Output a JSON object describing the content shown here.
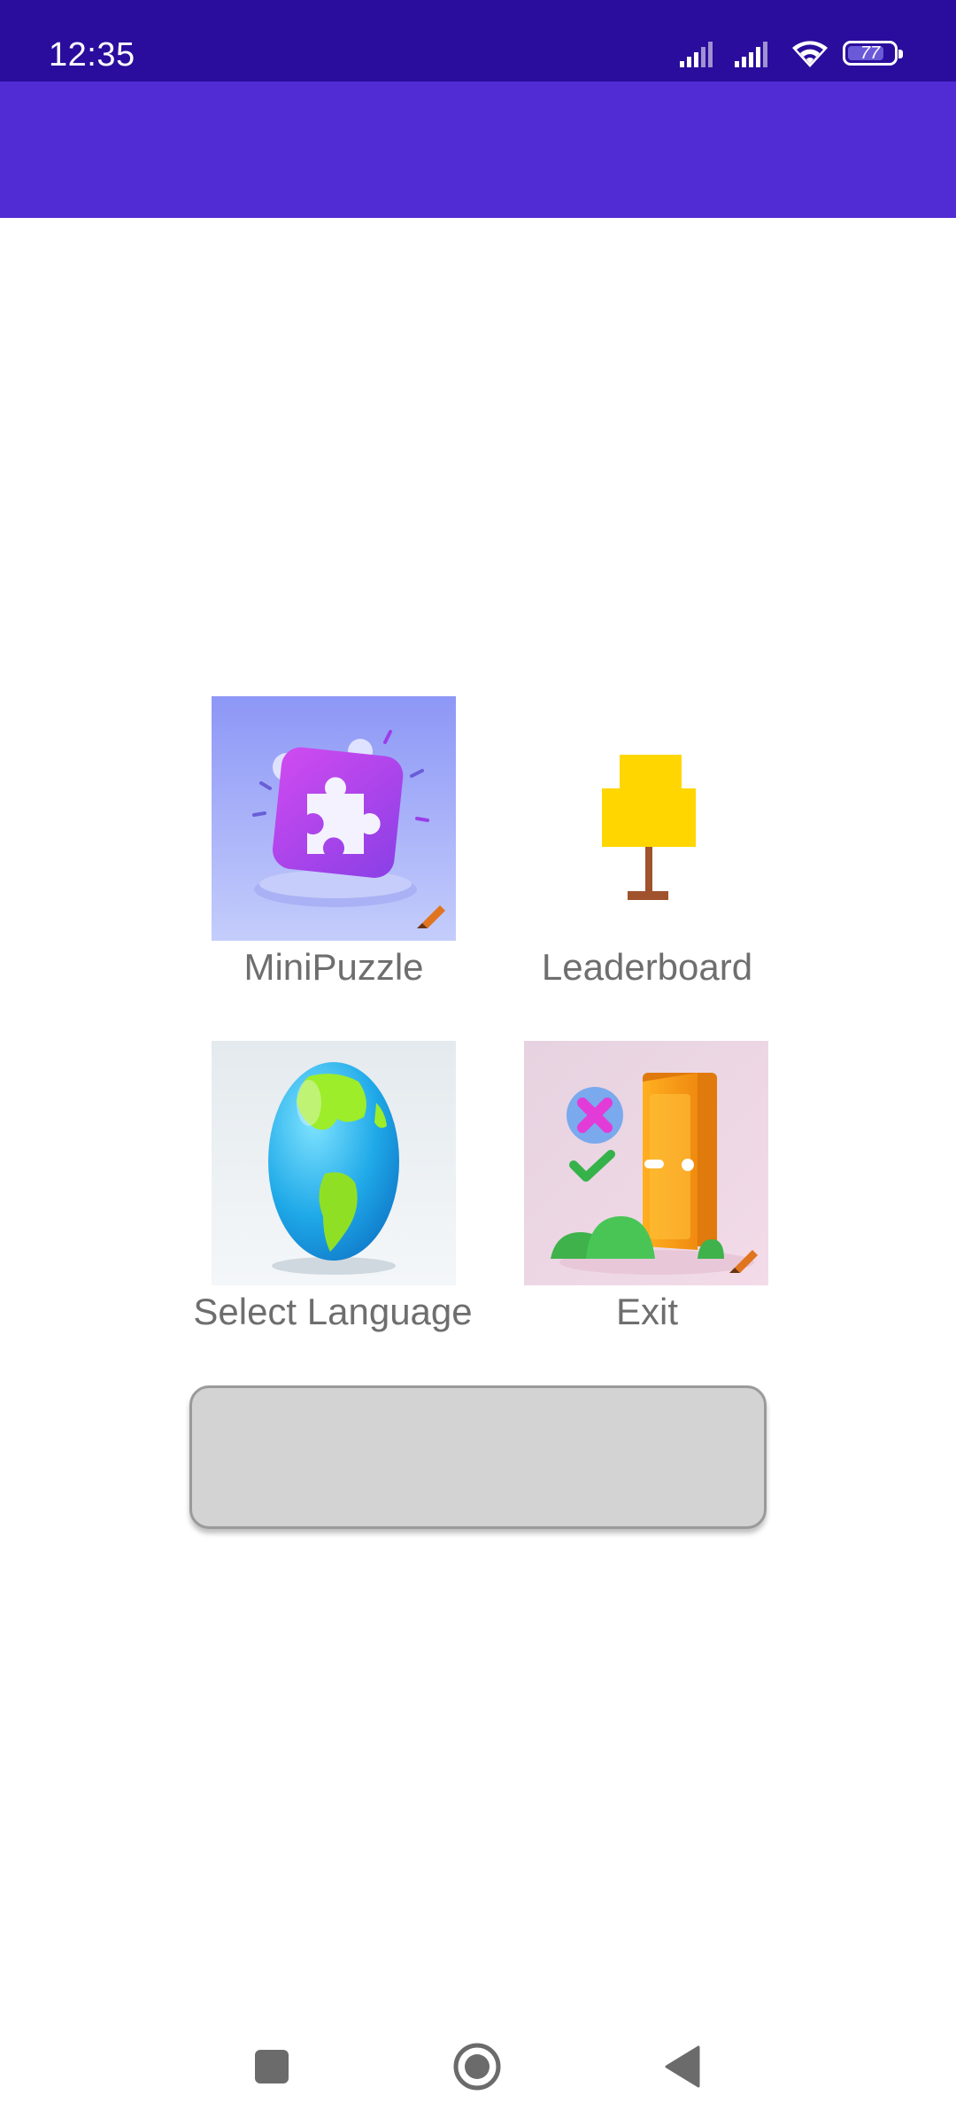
{
  "status_bar": {
    "time": "12:35",
    "battery": "77",
    "icons": [
      "signal-icon",
      "signal-icon",
      "wifi-icon",
      "battery-icon"
    ]
  },
  "app_bar": {
    "color": "#512bd4"
  },
  "menu": {
    "items": [
      {
        "label": "MiniPuzzle",
        "icon": "puzzle-icon"
      },
      {
        "label": "Leaderboard",
        "icon": "trophy-lamp-icon"
      },
      {
        "label": "Select Language",
        "icon": "globe-icon"
      },
      {
        "label": "Exit",
        "icon": "door-icon"
      }
    ]
  },
  "action_button": {
    "label": ""
  },
  "nav": {
    "items": [
      "recents-icon",
      "home-icon",
      "back-icon"
    ]
  },
  "colors": {
    "status_bar": "#2a0d9c",
    "app_bar": "#512bd4",
    "label_text": "#6e6e6e",
    "button_bg": "#d3d3d3"
  }
}
